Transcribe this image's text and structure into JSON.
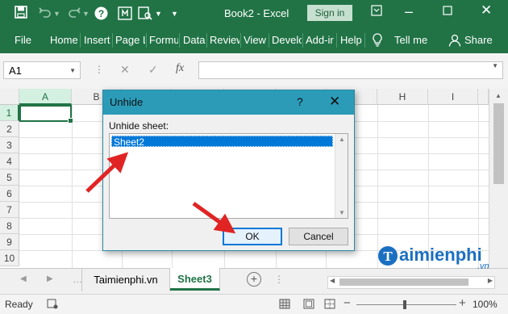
{
  "window": {
    "title": "Book2 - Excel",
    "sign_in": "Sign in",
    "icons": [
      "save-icon",
      "undo-icon",
      "redo-icon",
      "help-icon",
      "touch-mode-icon",
      "print-preview-icon",
      "customize-qat-icon",
      "ribbon-display-icon",
      "minimize-icon",
      "maximize-icon",
      "close-icon"
    ]
  },
  "ribbon": {
    "tabs": [
      "File",
      "Home",
      "Insert",
      "Page L",
      "Formu",
      "Data",
      "Review",
      "View",
      "Develo",
      "Add-ir",
      "Help"
    ],
    "tell_me": "Tell me",
    "share": "Share"
  },
  "formula_bar": {
    "name_box": "A1",
    "cancel_glyph": "✕",
    "enter_glyph": "✓",
    "fx_label": "fx",
    "formula_value": ""
  },
  "grid": {
    "columns": [
      "A",
      "B",
      "",
      "",
      "",
      "",
      "",
      "H",
      "I"
    ],
    "rows": [
      "1",
      "2",
      "3",
      "4",
      "5",
      "6",
      "7",
      "8",
      "9",
      "10"
    ]
  },
  "sheet_tabs": {
    "tabs": [
      "Taimienphi.vn",
      "Sheet3"
    ],
    "active": "Sheet3"
  },
  "status_bar": {
    "status": "Ready",
    "zoom": "100%"
  },
  "dialog": {
    "title": "Unhide",
    "help_glyph": "?",
    "close_glyph": "✕",
    "label": "Unhide sheet:",
    "items": [
      "Sheet2"
    ],
    "ok_label": "OK",
    "cancel_label": "Cancel"
  },
  "watermark": {
    "brand_initial": "T",
    "brand": "aimienphi",
    "tld": ".vn"
  },
  "colors": {
    "excel_green": "#217346",
    "dialog_title": "#2b9bb8",
    "selection": "#0078d7",
    "arrow_red": "#e02424",
    "watermark_blue": "#1a6fc1"
  }
}
